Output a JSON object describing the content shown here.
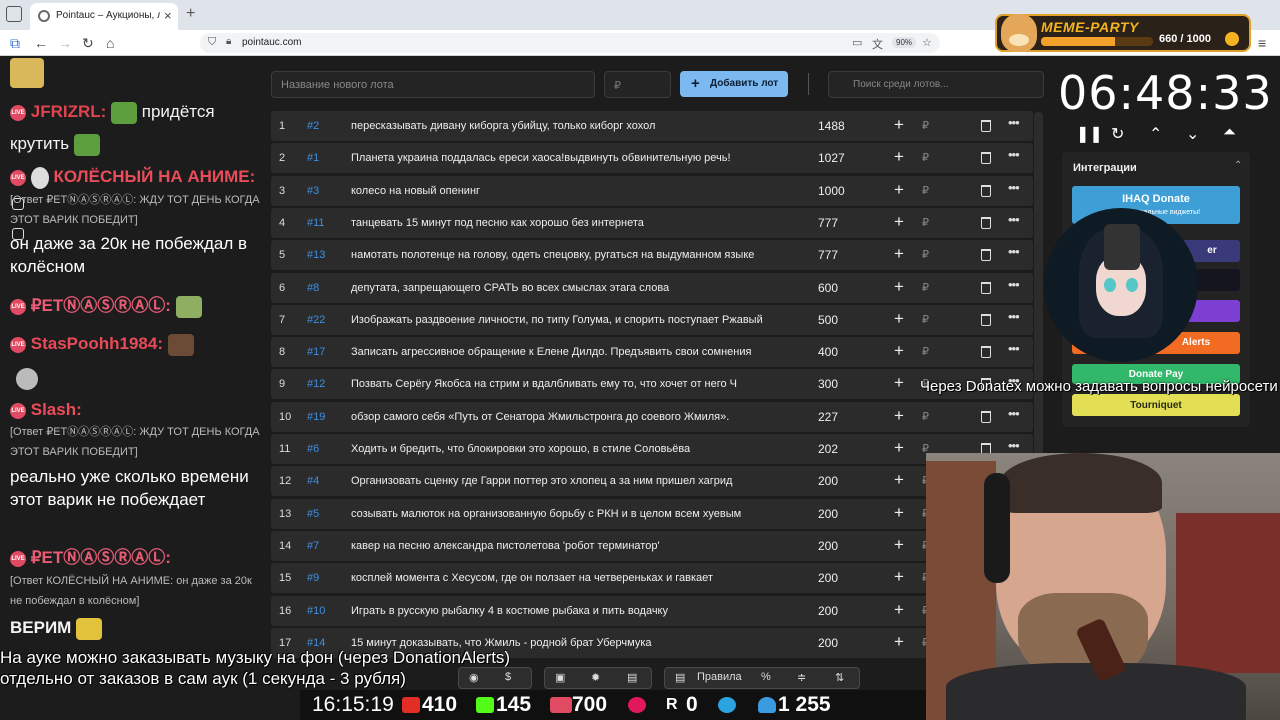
{
  "browser": {
    "tab_title": "Pointauc – Аукционы, лотереи",
    "url": "pointauc.com",
    "zoom": "90%"
  },
  "meme_party": {
    "title": "MEME-PARTY",
    "count": "660 / 1000",
    "progress": 0.66
  },
  "chat": {
    "m1_nick": "JFRIZRL:",
    "m1_text": "придётся",
    "m1_text2": "крутить",
    "m2_nick": "КОЛЁСНЫЙ НА АНИМЕ:",
    "m2_reply": "[Ответ ₽ЕТⓃⒶⓈⓇⒶⓁ: ЖДУ ТОТ ДЕНЬ КОГДА ЭТОТ ВАРИК ПОБЕДИТ]",
    "m2_text": "он даже за 20к не побеждал в колёсном",
    "m3_nick": "₽ЕТⓃⒶⓈⓇⒶⓁ:",
    "m4_nick": "StasPoohh1984:",
    "m5_nick": "Slash:",
    "m5_reply": "[Ответ ₽ЕТⓃⒶⓈⓇⒶⓁ: ЖДУ ТОТ ДЕНЬ КОГДА ЭТОТ ВАРИК ПОБЕДИТ]",
    "m5_text": "реально уже сколько времени этот варик не побеждает",
    "m6_nick": "₽ЕТⓃⒶⓈⓇⒶⓁ:",
    "m6_reply": "[Ответ КОЛЁСНЫЙ НА АНИМЕ: он даже за 20к не побеждал в колёсном]",
    "m6_text": "ВЕРИМ"
  },
  "toolbar": {
    "lot_placeholder": "Название нового лота",
    "price_placeholder": "₽",
    "add_label": "Добавить лот",
    "search_placeholder": "Поиск среди лотов..."
  },
  "lots": [
    {
      "idx": "1",
      "fid": "#2",
      "name": "пересказывать дивану киборга убийцу, только киборг хохол",
      "amount": "1488"
    },
    {
      "idx": "2",
      "fid": "#1",
      "name": "Планета украина поддалась ереси хаоса!выдвинуть обвинительную речь!",
      "amount": "1027"
    },
    {
      "idx": "3",
      "fid": "#3",
      "name": "колесо на новый опенинг",
      "amount": "1000"
    },
    {
      "idx": "4",
      "fid": "#11",
      "name": "танцевать 15 минут под песню как хорошо без интернета",
      "amount": "777"
    },
    {
      "idx": "5",
      "fid": "#13",
      "name": "намотать полотенце на голову, одеть спецовку, ругаться на выдуманном языке",
      "amount": "777"
    },
    {
      "idx": "6",
      "fid": "#8",
      "name": "депутата, запрещающего СРАТЬ во всех смыслах этага слова",
      "amount": "600"
    },
    {
      "idx": "7",
      "fid": "#22",
      "name": "Изображать раздвоение личности, по типу Голума, и спорить поступает Ржавый",
      "amount": "500"
    },
    {
      "idx": "8",
      "fid": "#17",
      "name": "Записать агрессивное обращение к Елене Дилдо. Предъявить свои сомнения",
      "amount": "400"
    },
    {
      "idx": "9",
      "fid": "#12",
      "name": "Позвать Серёгу Якобса на стрим и вдалбливать ему то, что хочет от него Ч",
      "amount": "300"
    },
    {
      "idx": "10",
      "fid": "#19",
      "name": "обзор самого себя «Путь от Сенатора Жмильстронга до соевого Жмиля».",
      "amount": "227"
    },
    {
      "idx": "11",
      "fid": "#6",
      "name": "Ходить и бредить, что блокировки это хорошо, в стиле Соловьёва",
      "amount": "202"
    },
    {
      "idx": "12",
      "fid": "#4",
      "name": "Организовать сценку где Гарри поттер это хлопец а за ним пришел хагрид",
      "amount": "200"
    },
    {
      "idx": "13",
      "fid": "#5",
      "name": "созывать малюток на организованную борьбу с РКН и в целом всем хуевым",
      "amount": "200"
    },
    {
      "idx": "14",
      "fid": "#7",
      "name": "кавер на песню александра пистолетова 'робот терминатор'",
      "amount": "200"
    },
    {
      "idx": "15",
      "fid": "#9",
      "name": "косплей момента с Хесусом, где он ползает на четвереньках и гавкает",
      "amount": "200"
    },
    {
      "idx": "16",
      "fid": "#10",
      "name": "Играть в русскую рыбалку 4 в костюме рыбака и пить водачку",
      "amount": "200"
    },
    {
      "idx": "17",
      "fid": "#14",
      "name": "15 минут доказывать, что Жмиль - родной брат Уберчмука",
      "amount": "200"
    }
  ],
  "timer": "06:48:33",
  "integrations": {
    "title": "Интеграции",
    "b1": "IHAQ Donate",
    "b1_sub": "Куча уникальные виджеты!",
    "b2": "er",
    "b5": "Alerts",
    "b6": "Donate Pay",
    "b7": "Tourniquet"
  },
  "overlay_donatex": "Через Donatex можно задавать вопросы нейросети",
  "bottom": {
    "line1": "На ауке можно заказывать музыку на фон (через DonationAlerts)",
    "line2": "отдельно от заказов в сам аук (1 секунда - 3 рубля)",
    "rules": "Правила"
  },
  "stats": {
    "time": "16:15:19",
    "youtube": "410",
    "kick": "145",
    "vk": "700",
    "rutube": "0",
    "r": "0",
    "viewers": "1 255"
  },
  "colors": {
    "accent": "#7cb9f0",
    "link": "#3f8ee0",
    "live": "#e04a62"
  }
}
